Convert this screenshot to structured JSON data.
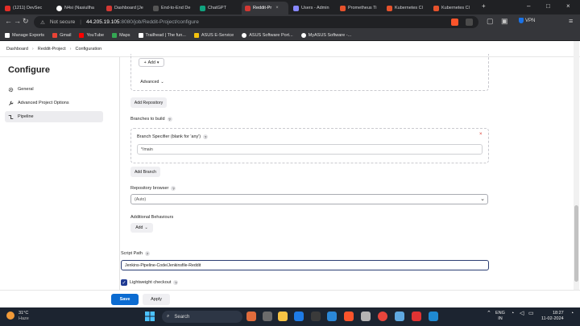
{
  "browser": {
    "tabs": [
      {
        "label": "(1211) DevSec",
        "color": "#e52d27"
      },
      {
        "label": "N4si (Nasiullha",
        "color": "#ffffff"
      },
      {
        "label": "Dashboard [Je",
        "color": "#d33833"
      },
      {
        "label": "End-to-End De",
        "color": "#555555"
      },
      {
        "label": "ChatGPT",
        "color": "#10a37f"
      },
      {
        "label": "Reddit-Pr",
        "color": "#d33833"
      },
      {
        "label": "Users - Admin",
        "color": "#8888ff"
      },
      {
        "label": "Prometheus Ti",
        "color": "#e6522c"
      },
      {
        "label": "Kubernetes Cl",
        "color": "#e6522c"
      },
      {
        "label": "Kubernetes Cl",
        "color": "#e6522c"
      }
    ],
    "new_tab": "+",
    "url": {
      "security": "Not secure",
      "host": "44.205.19.105",
      "path": ":8080/job/Reddit-Project/configure"
    },
    "vpn": "VPN",
    "bookmarks": [
      {
        "label": "Manage Exports",
        "color": "#ffffff"
      },
      {
        "label": "Gmail",
        "color": "#ea4335"
      },
      {
        "label": "YouTube",
        "color": "#ff0000"
      },
      {
        "label": "Maps",
        "color": "#34a853"
      },
      {
        "label": "Trailhead | The fun...",
        "color": "#ffffff"
      },
      {
        "label": "ASUS E-Service",
        "color": "#f4c20d"
      },
      {
        "label": "ASUS Software Port...",
        "color": "#ffffff"
      },
      {
        "label": "MyASUS Software -...",
        "color": "#ffffff"
      }
    ]
  },
  "breadcrumb": [
    "Dashboard",
    "Reddit-Project",
    "Configuration"
  ],
  "page_title": "Configure",
  "sidebar": [
    {
      "label": "General",
      "icon": "gear-icon"
    },
    {
      "label": "Advanced Project Options",
      "icon": "wrench-icon"
    },
    {
      "label": "Pipeline",
      "icon": "pipeline-icon"
    }
  ],
  "form": {
    "add_label": "Add",
    "advanced_label": "Advanced",
    "add_repository_label": "Add Repository",
    "branches_label": "Branches to build",
    "branch_specifier_label": "Branch Specifier (blank for 'any')",
    "branch_specifier_value": "*/main",
    "add_branch_label": "Add Branch",
    "repo_browser_label": "Repository browser",
    "repo_browser_value": "(Auto)",
    "additional_behaviours_label": "Additional Behaviours",
    "add2_label": "Add",
    "script_path_label": "Script Path",
    "script_path_value": "Jenkins-Pipeline-Code/Jenkinsfile-Reddit",
    "lightweight_label": "Lightweight checkout",
    "lightweight_checked": true,
    "help": "?",
    "close": "×"
  },
  "actions": {
    "save_label": "Save",
    "apply_label": "Apply"
  },
  "taskbar": {
    "weather_temp": "31°C",
    "weather_desc": "Haze",
    "search_placeholder": "Search",
    "lang_line1": "ENG",
    "lang_line2": "IN",
    "time": "18:27",
    "date": "11-02-2024"
  }
}
